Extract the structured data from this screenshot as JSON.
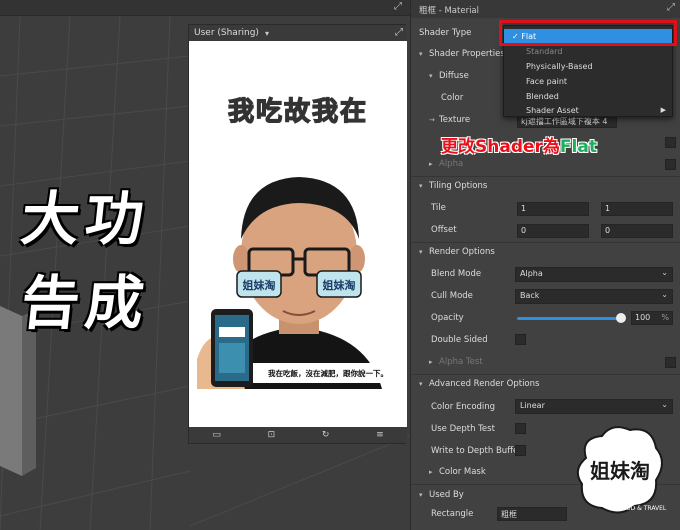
{
  "viewport": {
    "overlay_line1": "大功",
    "overlay_line2": "告成"
  },
  "preview": {
    "title": "User (Sharing)",
    "headline": "我吃故我在",
    "caption": "我在吃飯，沒在減肥，跟你說一下。",
    "glasses_text": "姐妹淘"
  },
  "inspector": {
    "title": "粗框 - Material",
    "shader_type_label": "Shader Type",
    "shader_properties": "Shader Properties",
    "diffuse": "Diffuse",
    "color": "Color",
    "texture": "Texture",
    "texture_value": "kj遮擋工作區域下複本 4",
    "alpha": "Alpha",
    "tiling_options": "Tiling Options",
    "tile": "Tile",
    "tile_x": "1",
    "tile_y": "1",
    "offset": "Offset",
    "offset_x": "0",
    "offset_y": "0",
    "render_options": "Render Options",
    "blend_mode": "Blend Mode",
    "blend_mode_value": "Alpha",
    "cull_mode": "Cull Mode",
    "cull_mode_value": "Back",
    "opacity": "Opacity",
    "opacity_value": "100",
    "opacity_unit": "%",
    "double_sided": "Double Sided",
    "alpha_test": "Alpha Test",
    "advanced_render_options": "Advanced Render Options",
    "color_encoding": "Color Encoding",
    "color_encoding_value": "Linear",
    "use_depth_test": "Use Depth Test",
    "write_depth": "Write to Depth Buffer",
    "color_mask": "Color Mask",
    "used_by": "Used By",
    "rectangle": "Rectangle",
    "rectangle_value": "粗框"
  },
  "dropdown": {
    "options": [
      {
        "label": "Flat",
        "selected": true
      },
      {
        "label": "Standard",
        "selected": false
      },
      {
        "label": "Physically-Based",
        "selected": false
      },
      {
        "label": "Face paint",
        "selected": false
      },
      {
        "label": "Blended",
        "selected": false
      },
      {
        "label": "Shader Asset",
        "selected": false
      }
    ],
    "checkmark": "✓"
  },
  "callout": {
    "prefix": "更改Shader為",
    "flat": "Flat"
  },
  "logo": {
    "text": "姐妹淘",
    "subtitle": "FOOD & TRAVEL"
  },
  "colors": {
    "accent": "#2f8fe0",
    "highlight_red": "#e0101a",
    "callout_green": "#1fae5d"
  }
}
